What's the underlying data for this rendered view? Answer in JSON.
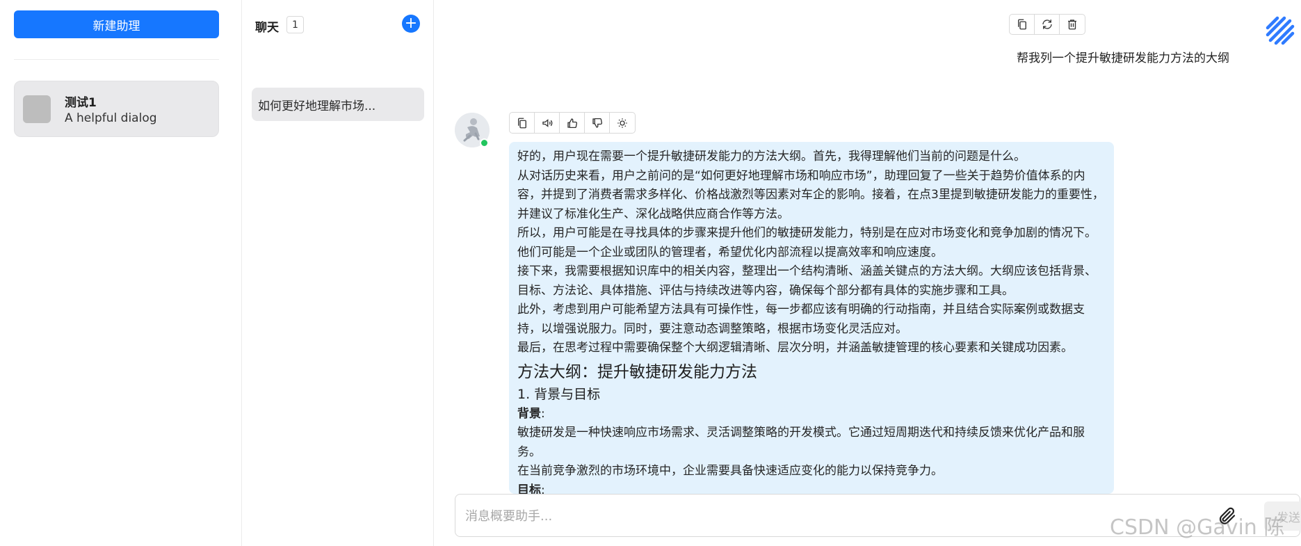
{
  "assistants": {
    "new_button_label": "新建助理",
    "items": [
      {
        "name": "测试1",
        "description": "A helpful dialog"
      }
    ]
  },
  "chats": {
    "title": "聊天",
    "count": "1",
    "items": [
      {
        "title": "如何更好地理解市场..."
      }
    ]
  },
  "conversation": {
    "user_message": "帮我列一个提升敏捷研发能力方法的大纲",
    "bot_paragraphs": [
      "好的，用户现在需要一个提升敏捷研发能力的方法大纲。首先，我得理解他们当前的问题是什么。",
      "从对话历史来看，用户之前问的是“如何更好地理解市场和响应市场”，助理回复了一些关于趋势价值体系的内容，并提到了消费者需求多样化、价格战激烈等因素对车企的影响。接着，在点3里提到敏捷研发能力的重要性，并建议了标准化生产、深化战略供应商合作等方法。",
      "所以，用户可能是在寻找具体的步骤来提升他们的敏捷研发能力，特别是在应对市场变化和竞争加剧的情况下。他们可能是一个企业或团队的管理者，希望优化内部流程以提高效率和响应速度。",
      "接下来，我需要根据知识库中的相关内容，整理出一个结构清晰、涵盖关键点的方法大纲。大纲应该包括背景、目标、方法论、具体措施、评估与持续改进等内容，确保每个部分都有具体的实施步骤和工具。",
      "此外，考虑到用户可能希望方法具有可操作性，每一步都应该有明确的行动指南，并且结合实际案例或数据支持，以增强说服力。同时，要注意动态调整策略，根据市场变化灵活应对。",
      "最后，在思考过程中需要确保整个大纲逻辑清晰、层次分明，并涵盖敏捷管理的核心要素和关键成功因素。"
    ],
    "outline_title": "方法大纲：提升敏捷研发能力方法",
    "section_1_title": "1. 背景与目标",
    "background_label": "背景",
    "background_colon": ":",
    "background_text_1": "敏捷研发是一种快速响应市场需求、灵活调整策略的开发模式。它通过短周期迭代和持续反馈来优化产品和服务。",
    "background_text_2": "在当前竞争激烈的市场环境中，企业需要具备快速适应变化的能力以保持竞争力。",
    "goal_label": "目标",
    "goal_colon": ":"
  },
  "composer": {
    "placeholder": "消息概要助手...",
    "send_label": "发送"
  },
  "watermark": "CSDN @Gavin 陈",
  "colors": {
    "primary": "#1677ff",
    "bubble": "#e3f2fd",
    "online": "#22c55e"
  },
  "icons": {
    "user_actions": [
      "copy-icon",
      "refresh-icon",
      "delete-icon"
    ],
    "bot_actions": [
      "copy-icon",
      "speaker-icon",
      "thumbs-up-icon",
      "thumbs-down-icon",
      "lightbulb-icon"
    ]
  }
}
